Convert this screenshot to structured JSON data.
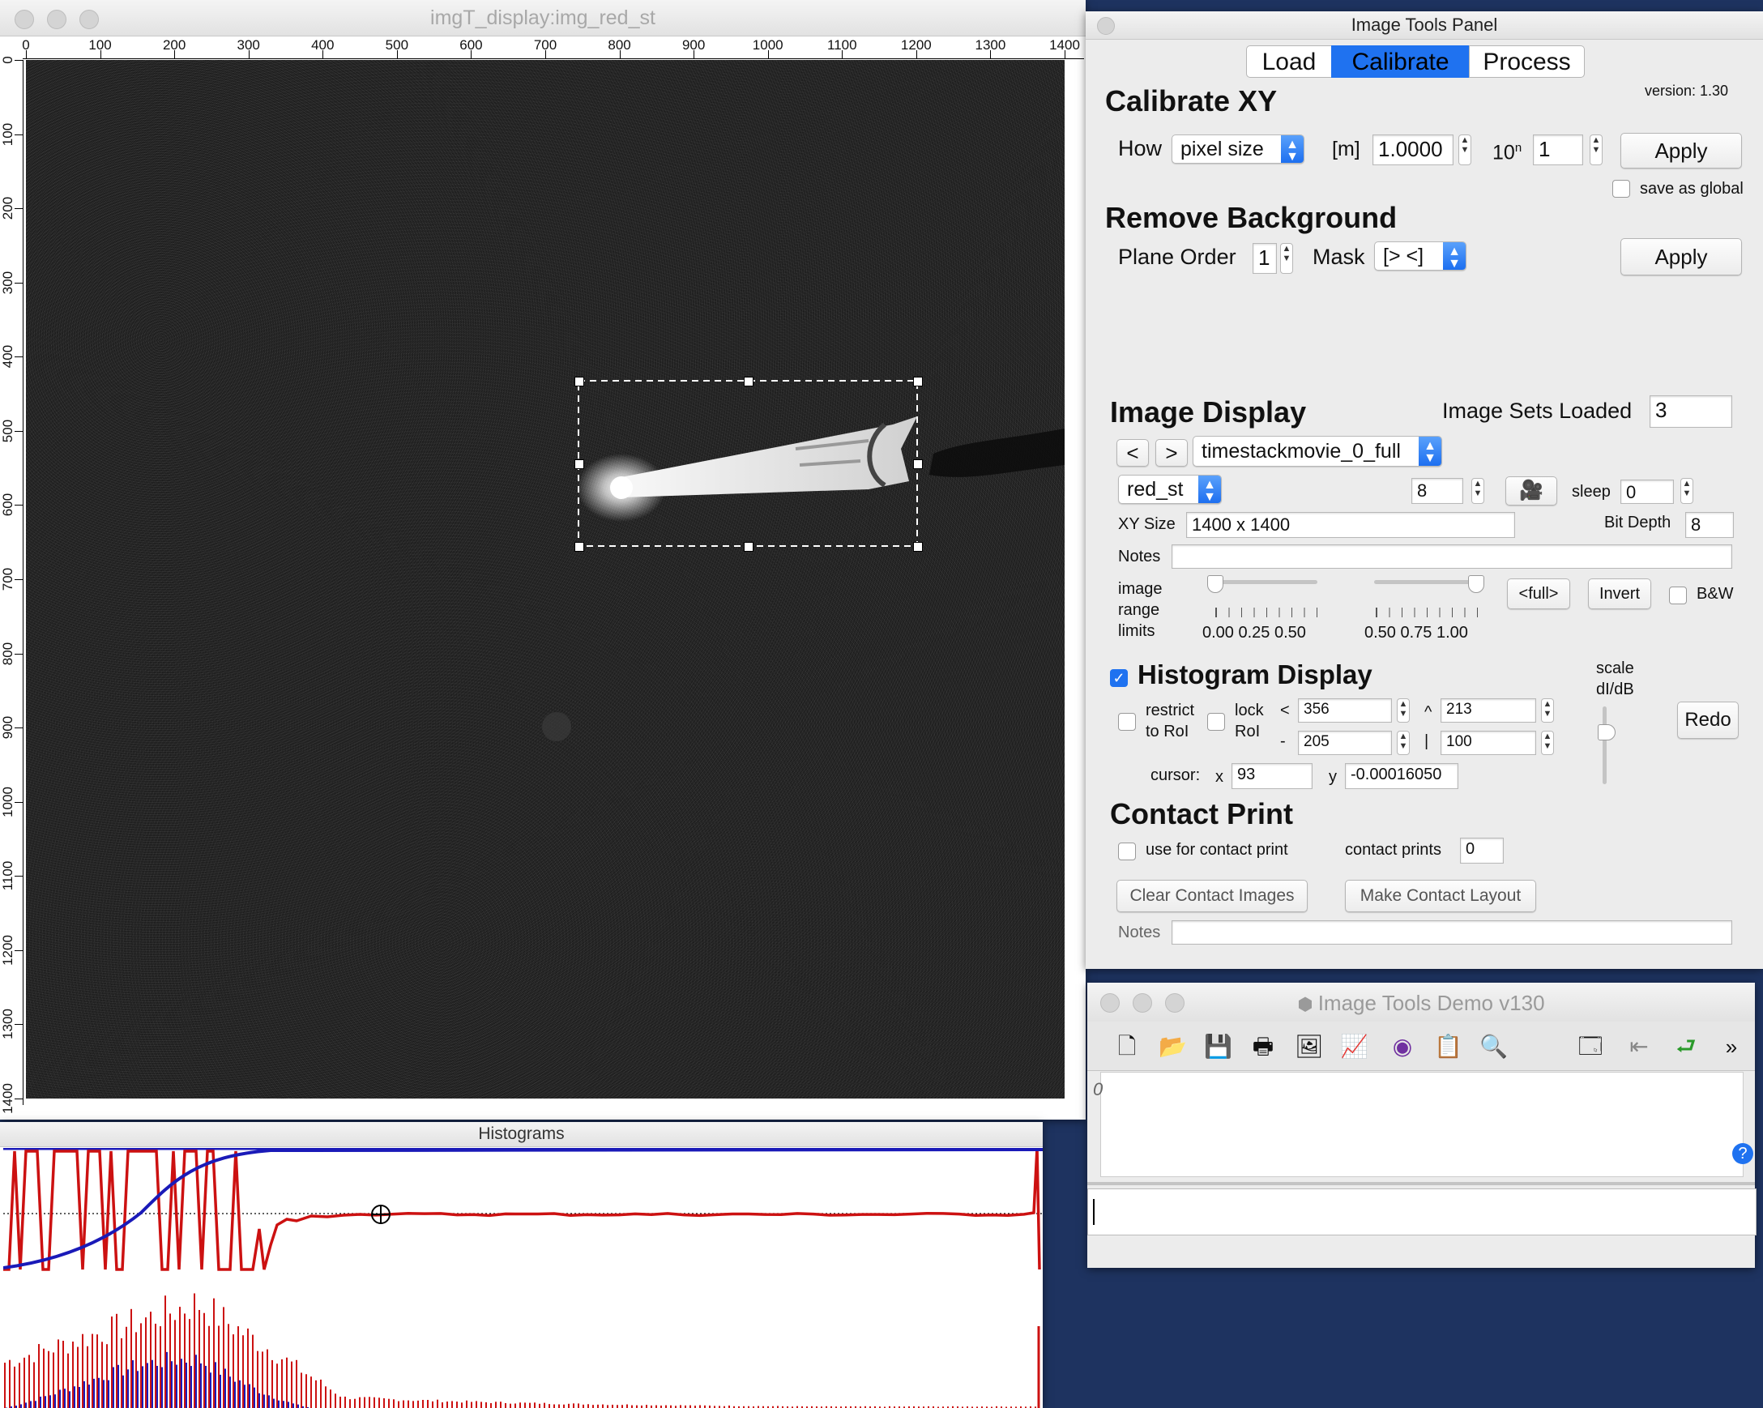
{
  "image_window": {
    "title": "imgT_display:img_red_st",
    "x_ticks": [
      "0",
      "100",
      "200",
      "300",
      "400",
      "500",
      "600",
      "700",
      "800",
      "900",
      "1000",
      "1100",
      "1200",
      "1300",
      "1400"
    ],
    "y_ticks": [
      "0",
      "100",
      "200",
      "300",
      "400",
      "500",
      "600",
      "700",
      "800",
      "900",
      "1000",
      "1100",
      "1200",
      "1300",
      "1400"
    ]
  },
  "histograms": {
    "title": "Histograms"
  },
  "panel": {
    "title": "Image Tools Panel",
    "tabs": [
      "Load",
      "Calibrate",
      "Process"
    ],
    "selected_tab": "Calibrate",
    "version": "version: 1.30",
    "calibrate": {
      "heading": "Calibrate XY",
      "how_label": "How",
      "how_value": "pixel size",
      "unit_label": "[m]",
      "size_value": "1.0000",
      "exp_label_base": "10",
      "exp_label_sup": "n",
      "exp_value": "1",
      "apply": "Apply",
      "save_global": "save as global"
    },
    "background": {
      "heading": "Remove Background",
      "plane_order_label": "Plane Order",
      "plane_order_value": "1",
      "mask_label": "Mask",
      "mask_value": "[> <]",
      "apply": "Apply"
    },
    "display": {
      "heading": "Image Display",
      "sets_loaded_label": "Image Sets Loaded",
      "sets_loaded_value": "3",
      "prev": "<",
      "next": ">",
      "set_name": "timestackmovie_0_full",
      "channel": "red_st",
      "frame_value": "8",
      "sleep_label": "sleep",
      "sleep_value": "0",
      "xy_label": "XY Size",
      "xy_value": "1400 x 1400",
      "bitdepth_label": "Bit Depth",
      "bitdepth_value": "8",
      "notes_label": "Notes",
      "notes_value": "",
      "range_label_1": "image",
      "range_label_2": "range",
      "range_label_3": "limits",
      "low_ticks": "0.00  0.25  0.50",
      "high_ticks": "0.50  0.75  1.00",
      "low_value": 0.0,
      "high_value": 1.0,
      "full": "<full>",
      "invert": "Invert",
      "bw": "B&W"
    },
    "histogram": {
      "heading": "Histogram Display",
      "enabled": true,
      "restrict_1": "restrict",
      "restrict_2": "to RoI",
      "lock_1": "lock",
      "lock_2": "RoI",
      "lt_symbol": "<",
      "lt_value": "356",
      "caret_symbol": "^",
      "caret_value": "213",
      "dash_symbol": "-",
      "dash_value": "205",
      "bar_symbol": "|",
      "bar_value": "100",
      "scale_1": "scale",
      "scale_2": "dI/dB",
      "redo": "Redo",
      "cursor_label": "cursor:",
      "cursor_x_label": "x",
      "cursor_x": "93",
      "cursor_y_label": "y",
      "cursor_y": "-0.00016050"
    },
    "contact": {
      "heading": "Contact Print",
      "use_label": "use for contact print",
      "prints_label": "contact prints",
      "prints_value": "0",
      "clear": "Clear Contact Images",
      "make": "Make Contact Layout",
      "notes_label": "Notes",
      "notes_value": ""
    }
  },
  "demo": {
    "title": "Image Tools Demo v130",
    "history_text": "0",
    "toolbar_icons": [
      "new-document-icon",
      "open-folder-icon",
      "save-icon",
      "print-icon",
      "page-setup-icon",
      "graph-icon",
      "procedure-icon",
      "notebook-icon",
      "find-icon",
      "layout-icon",
      "back-icon",
      "return-icon",
      "more-icon"
    ]
  },
  "colors": {
    "accent": "#1f72f0",
    "histogram_red": "#cc1111",
    "histogram_blue": "#1a1ab8"
  }
}
